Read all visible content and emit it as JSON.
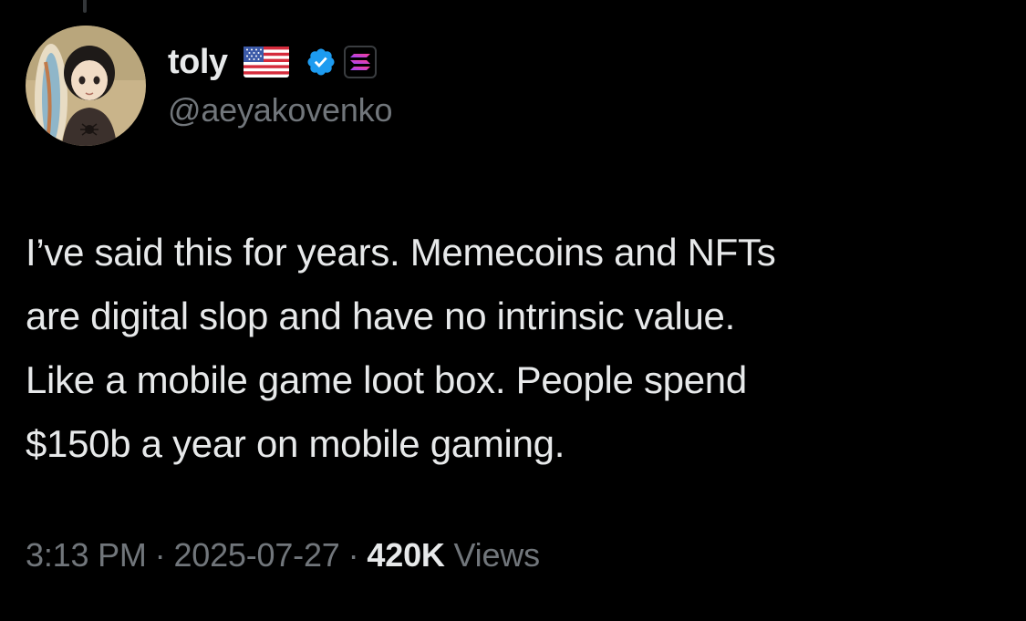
{
  "author": {
    "display_name": "toly",
    "handle": "@aeyakovenko",
    "badges": [
      "us-flag-icon",
      "verified-badge-icon",
      "solana-affiliate-icon"
    ]
  },
  "tweet": {
    "lines": [
      "I’ve said this for years.  Memecoins and NFTs",
      "are digital slop and have no intrinsic value.",
      "Like a mobile game loot box.  People spend",
      "$150b a year on mobile gaming."
    ]
  },
  "meta": {
    "time": "3:13 PM",
    "separator": "·",
    "date": "2025-07-27",
    "views_count": "420K",
    "views_label": "Views"
  },
  "colors": {
    "background": "#000000",
    "primary_text": "#e7e9ea",
    "secondary_text": "#71767b",
    "verified_blue": "#1d9bf0"
  }
}
